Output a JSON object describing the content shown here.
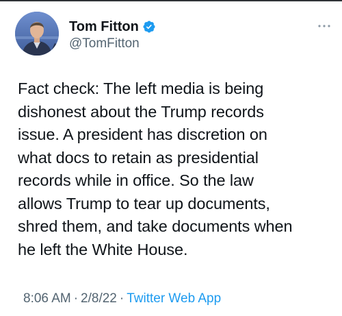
{
  "author": {
    "display_name": "Tom Fitton",
    "handle": "@TomFitton",
    "verified": true
  },
  "tweet": {
    "text_lines": [
      "Fact check: The left media is being",
      "dishonest about the Trump records",
      "issue. A president has discretion on",
      "what docs to retain as presidential",
      "records while in office. So the law",
      "allows Trump to tear up documents,",
      "shred them, and take documents when",
      "he left the White House."
    ],
    "time": "8:06 AM",
    "date": "2/8/22",
    "separator": "·",
    "source": "Twitter Web App"
  },
  "icons": {
    "verified": "verified-badge-icon",
    "more": "more-options-icon"
  },
  "colors": {
    "accent": "#1d9bf0",
    "text_primary": "#0f1419",
    "text_secondary": "#536471"
  }
}
